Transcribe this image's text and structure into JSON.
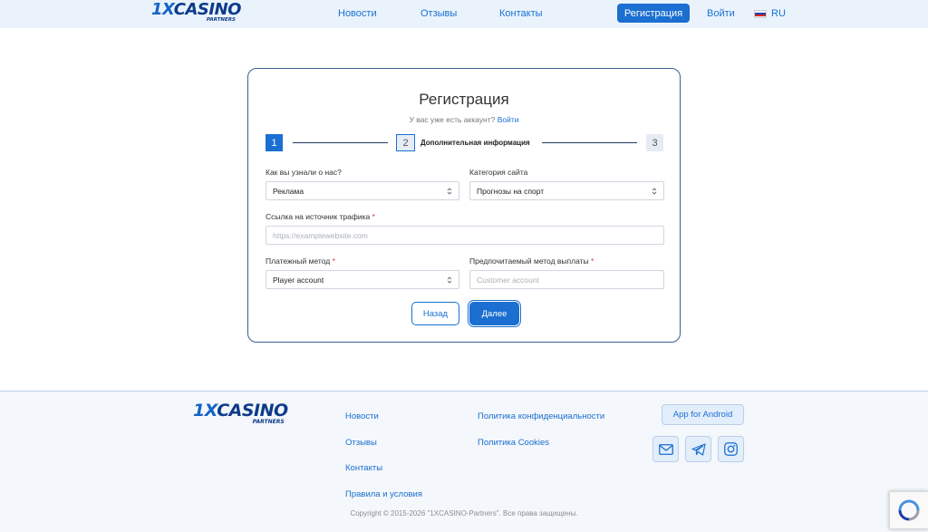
{
  "header": {
    "logo_main_prefix": "1X",
    "logo_main_rest": "CASINO",
    "logo_sub": "PARTNERS",
    "nav": [
      "Новости",
      "Отзывы",
      "Контакты"
    ],
    "register_label": "Регистрация",
    "login_label": "Войти",
    "lang_label": "RU"
  },
  "form": {
    "title": "Регистрация",
    "have_account_text": "У вас уже есть аккаунт?",
    "have_account_link": "Войти",
    "steps": {
      "step1": "1",
      "step2": "2",
      "step2_label": "Дополнительная информация",
      "step3": "3"
    },
    "how_found": {
      "label": "Как вы узнали о нас?",
      "value": "Реклама"
    },
    "site_category": {
      "label": "Категория сайта",
      "value": "Прогнозы на спорт"
    },
    "traffic_link": {
      "label": "Ссылка на источник трафика",
      "required": "*",
      "placeholder": "https://examplewebsite.com"
    },
    "payment_method": {
      "label": "Платежный метод",
      "required": "*",
      "value": "Player account"
    },
    "payout_method": {
      "label": "Предпочитаемый метод выплаты",
      "required": "*",
      "placeholder": "Customer account"
    },
    "back_label": "Назад",
    "next_label": "Далее"
  },
  "footer": {
    "col1": [
      "Новости",
      "Отзывы",
      "Контакты",
      "Правила и условия"
    ],
    "col2": [
      "Политика конфиденциальности",
      "Политика Cookies"
    ],
    "app_button": "App for Android",
    "social_icons": [
      "mail-icon",
      "telegram-icon",
      "instagram-icon"
    ],
    "copyright": "Copyright © 2015-2026 \"1XCASINO-Partners\". Все права защищены."
  },
  "colors": {
    "accent": "#1a6fd1",
    "header_bg": "#eaf3fc",
    "brand_dark": "#0e3b8a",
    "card_border": "#3b5f91"
  }
}
